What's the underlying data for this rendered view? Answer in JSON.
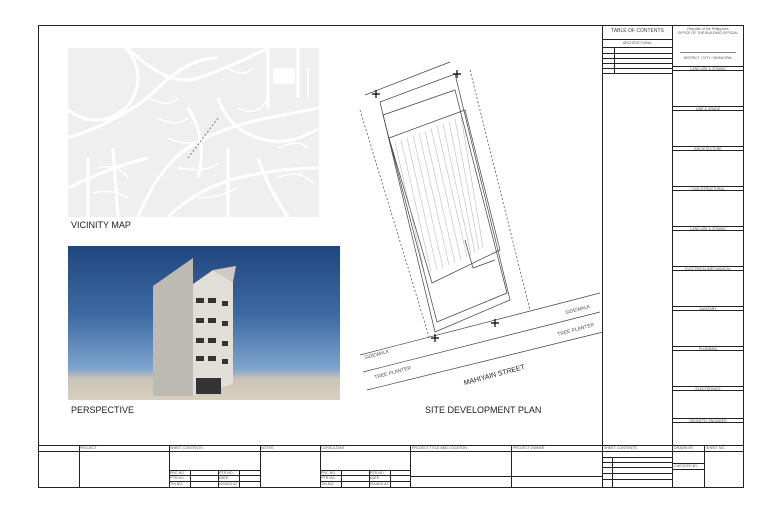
{
  "drawings": {
    "vicinity_map_label": "VICINITY MAP",
    "perspective_label": "PERSPECTIVE",
    "site_plan_label": "SITE DEVELOPMENT PLAN",
    "street_name": "MAHIYAIN STREET",
    "sidewalk": "SIDEWALK",
    "tree_planter": "TREE PLANTER"
  },
  "toc": {
    "title": "TABLE OF CONTENTS",
    "subtitle": "ARCHITECTURAL"
  },
  "office": {
    "line1": "Republic of the Philippines",
    "line2": "OFFICE OF THE BUILDING OFFICIAL",
    "district": "DISTRICT / CITY / MUNICIPAL",
    "sections": [
      "LAND USE & ZONING",
      "LINE & GRADE",
      "ARCHITECTURE",
      "CIVIL/STRUCTURAL",
      "LAND USE & ZONING",
      "ELECTRICAL/MECHANICAL",
      "SANITARY",
      "PLUMBING",
      "ELECTRONICS",
      "GEODETIC ENGINEER"
    ]
  },
  "title_block": {
    "project": "PROJECT",
    "sheet_contents": "SHEET CONTENTS",
    "notes": "NOTES",
    "consultant": "CONSULTANT",
    "project_title": "PROJECT TITLE AND LOCATION",
    "owner": "PROJECT OWNER",
    "sheet_contents2": "SHEET CONTENTS",
    "drawn_by": "DRAWN BY",
    "sheet_no": "SHEET NO.",
    "checked_by": "CHECKED BY",
    "prc_no": "PRC NO.",
    "ptr_no": "PTR NO.",
    "tin_no": "TIN NO.",
    "date": "DATE",
    "issued_at": "ISSUED AT"
  }
}
